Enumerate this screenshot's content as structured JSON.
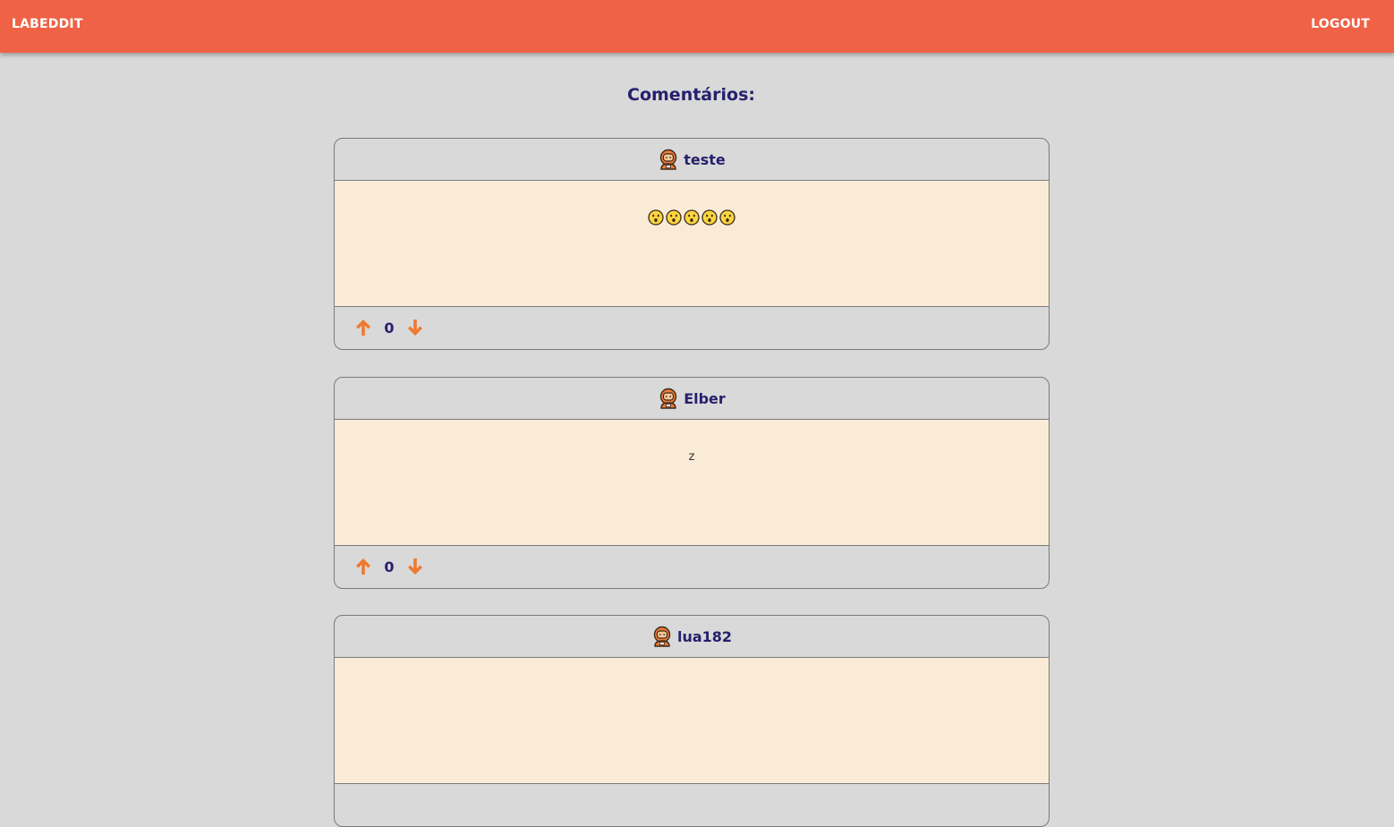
{
  "header": {
    "brand": "LABEDDIT",
    "logout_label": "LOGOUT",
    "bg_color": "#ef6246"
  },
  "page_title": "Comentários:",
  "comments": [
    {
      "author": "teste",
      "body": "😮😮😮😮😮",
      "votes": "0"
    },
    {
      "author": "Elber",
      "body": "z",
      "votes": "0"
    },
    {
      "author": "lua182",
      "body": "",
      "votes": ""
    }
  ],
  "icons": {
    "avatar": "astronaut-icon",
    "upvote": "arrow-up-icon",
    "downvote": "arrow-down-icon",
    "face": "astonished-face-icon"
  },
  "colors": {
    "accent": "#ef6246",
    "arrow": "#ee7a2e",
    "text": "#27206d",
    "card_body": "#faebd7",
    "background": "#d9d9d9"
  }
}
